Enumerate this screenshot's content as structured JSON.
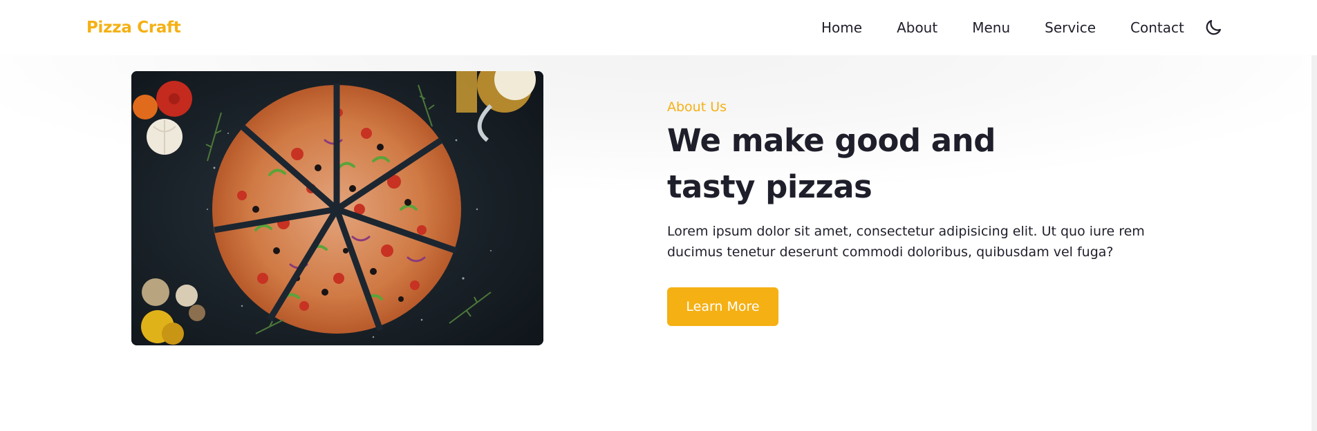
{
  "header": {
    "logo": "Pizza Craft",
    "nav": [
      "Home",
      "About",
      "Menu",
      "Service",
      "Contact"
    ],
    "theme_icon": "moon-icon"
  },
  "about": {
    "tag": "About Us",
    "title_line1": "We make good and",
    "title_line2": "tasty pizzas",
    "text": "Lorem ipsum dolor sit amet, consectetur adipisicing elit. Ut quo iure rem ducimus tenetur deserunt commodi doloribus, quibusdam vel fuga?",
    "button": "Learn More",
    "image": "sliced-pizza-photo"
  },
  "colors": {
    "accent": "#f5b014",
    "text": "#1f1f2b",
    "background": "#ffffff"
  }
}
